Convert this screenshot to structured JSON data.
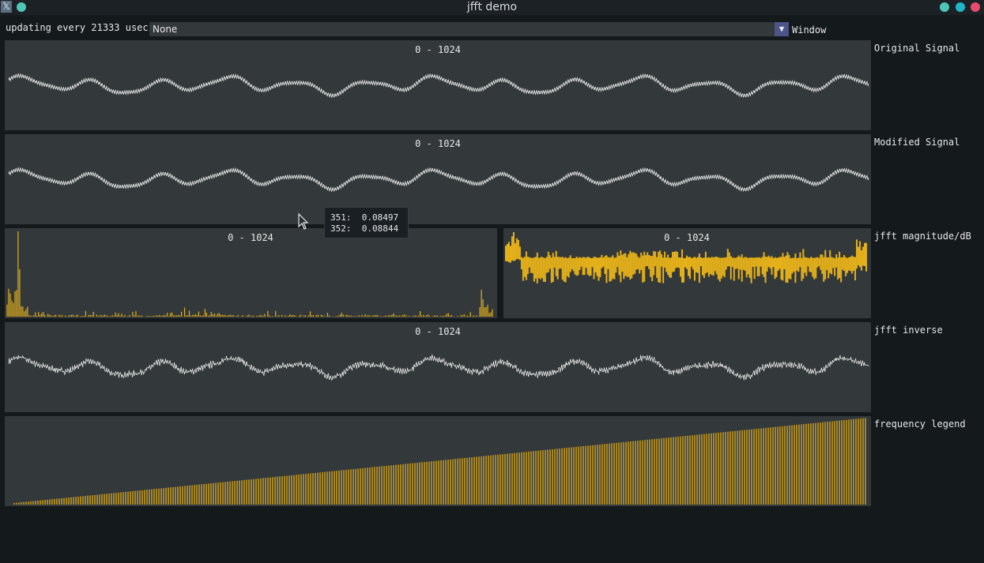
{
  "window": {
    "title": "jfft demo",
    "app_icon": "𝕏",
    "icon": "x11-app-icon",
    "controls": [
      {
        "name": "minimize",
        "color": "#4fc7b8"
      },
      {
        "name": "maximize",
        "color": "#1fb7c8"
      },
      {
        "name": "close",
        "color": "#e74c6c"
      }
    ],
    "sticky_color": "#4fc7b8"
  },
  "toolbar": {
    "update_text": "updating every 21333 usec",
    "window_select": {
      "value": "None",
      "label": "Window"
    }
  },
  "plots": {
    "original": {
      "range": "0 - 1024",
      "label": "Original Signal"
    },
    "modified": {
      "range": "0 - 1024",
      "label": "Modified Signal"
    },
    "fft_magnitude": {
      "range": "0 - 1024"
    },
    "fft_db": {
      "range": "0 - 1024",
      "label": "jfft magnitude/dB"
    },
    "inverse": {
      "range": "0 - 1024",
      "label": "jfft inverse"
    },
    "legend": {
      "label": "frequency legend"
    }
  },
  "tooltip": {
    "rows": [
      "351:  0.08497",
      "352:  0.08844"
    ]
  },
  "colors": {
    "background": "#14191c",
    "plot_bg": "#33383a",
    "line": "#e8e8e8",
    "histogram": "#e5b11a"
  }
}
